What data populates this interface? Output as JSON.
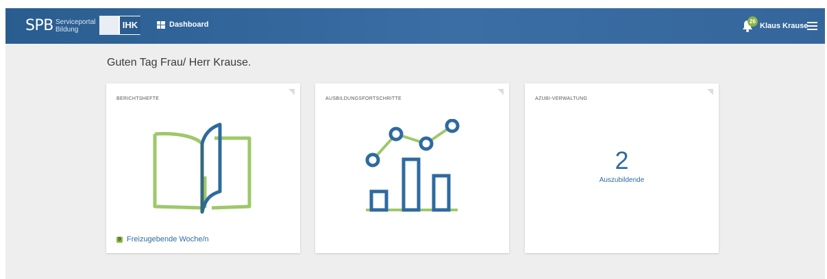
{
  "header": {
    "logo_text": "SPB",
    "logo_sub_1": "Serviceportal",
    "logo_sub_2": "Bildung",
    "ihk_label": "IHK",
    "nav_dashboard": "Dashboard",
    "notification_count": "26",
    "user_name": "Klaus Krause"
  },
  "greeting": "Guten Tag Frau/ Herr Krause.",
  "cards": [
    {
      "title": "BERICHTSHEFTE",
      "footer_count": "0",
      "footer_label": "Freizugebende Woche/n"
    },
    {
      "title": "AUSBILDUNGSFORTSCHRITTE"
    },
    {
      "title": "AZUBI-VERWALTUNG",
      "count": "2",
      "count_label": "Auszubildende"
    }
  ],
  "colors": {
    "header_blue": "#3a6ea5",
    "accent_blue": "#2e6aa1",
    "accent_green": "#8bb444",
    "background": "#eeeeee"
  },
  "icons": [
    "bell-icon",
    "menu-icon",
    "dashboard-icon",
    "book-icon",
    "progress-chart-icon"
  ]
}
